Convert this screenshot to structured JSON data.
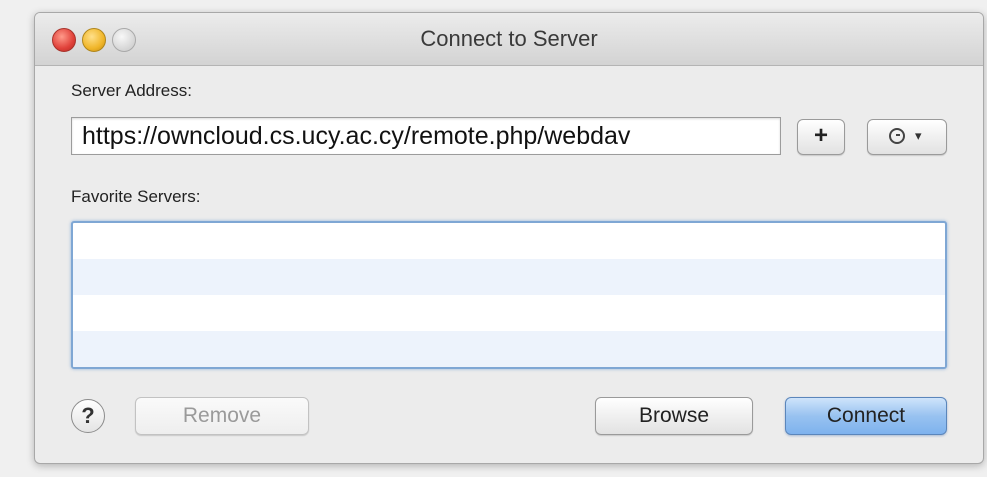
{
  "window": {
    "title": "Connect to Server"
  },
  "server_address": {
    "label": "Server Address:",
    "value": "https://owncloud.cs.ucy.ac.cy/remote.php/webdav",
    "add_label": "+",
    "recent_icon": "clock-icon",
    "caret": "▾"
  },
  "favorites": {
    "label": "Favorite Servers:",
    "rows": [
      "",
      "",
      "",
      ""
    ],
    "selection_color": "#7fa7d4"
  },
  "footer": {
    "help_label": "?",
    "remove_label": "Remove",
    "browse_label": "Browse",
    "connect_label": "Connect"
  },
  "colors": {
    "default_button": "#98c2f0",
    "close": "#e0413a",
    "minimize": "#f0b62a"
  }
}
